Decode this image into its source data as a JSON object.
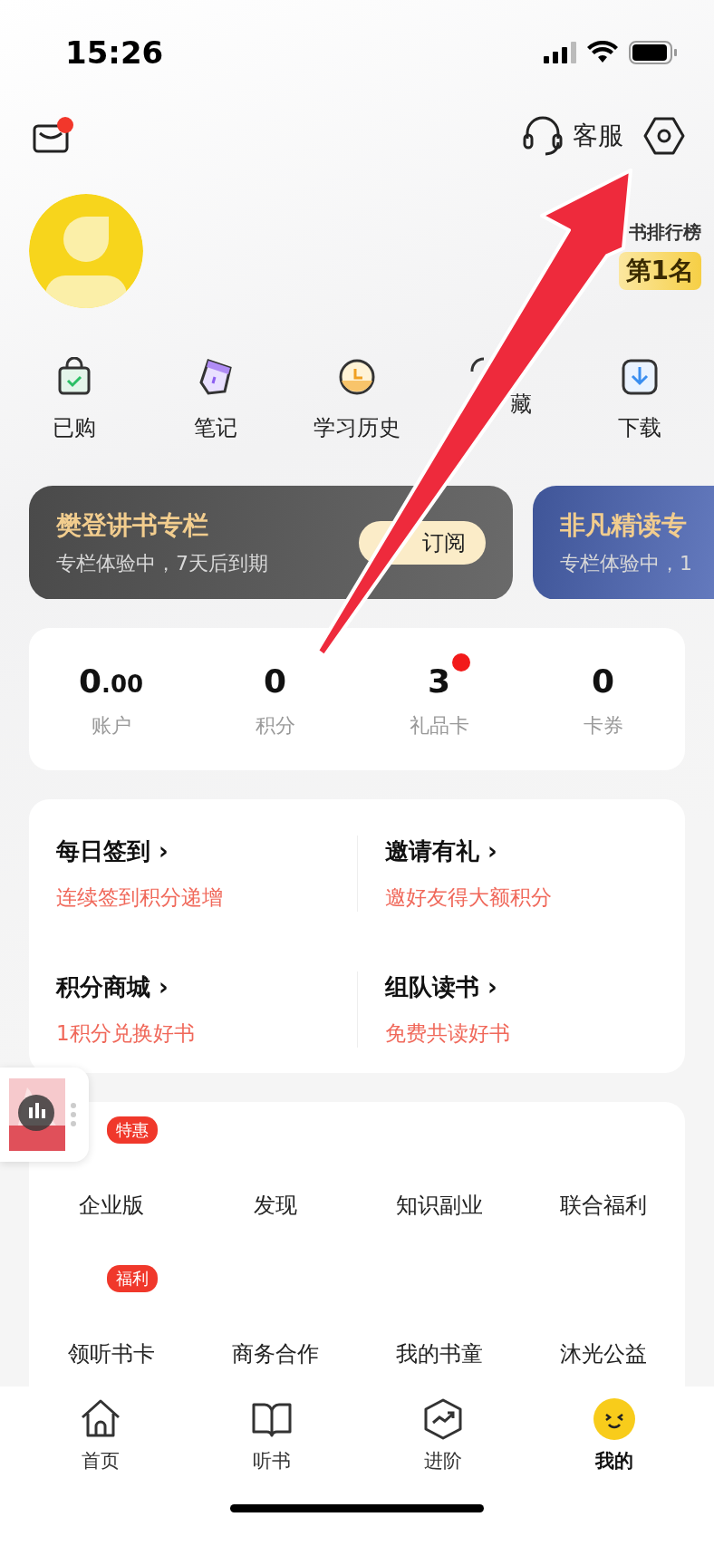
{
  "status_bar": {
    "time": "15:26"
  },
  "header": {
    "mail_badge": true,
    "service_label": "客服"
  },
  "rank_badge": {
    "title": "书排行榜",
    "rank": "第1名"
  },
  "shortcuts": [
    {
      "label": "已购"
    },
    {
      "label": "笔记"
    },
    {
      "label": "学习历史"
    },
    {
      "label": "藏"
    },
    {
      "label": "下载"
    }
  ],
  "columns": [
    {
      "title": "樊登讲书专栏",
      "subtitle": "专栏体验中，7天后到期",
      "button": "订阅"
    },
    {
      "title": "非凡精读专",
      "subtitle": "专栏体验中，1"
    }
  ],
  "stats": [
    {
      "value": "0.00",
      "label": "账户",
      "dot": false
    },
    {
      "value": "0",
      "label": "积分",
      "dot": false
    },
    {
      "value": "3",
      "label": "礼品卡",
      "dot": true
    },
    {
      "value": "0",
      "label": "卡券",
      "dot": false
    }
  ],
  "tasks": [
    {
      "title": "每日签到",
      "chevron": "›",
      "subtitle": "连续签到积分递增"
    },
    {
      "title": "邀请有礼",
      "chevron": "›",
      "subtitle": "邀好友得大额积分"
    },
    {
      "title": "积分商城",
      "chevron": "›",
      "subtitle": "1积分兑换好书"
    },
    {
      "title": "组队读书",
      "chevron": "›",
      "subtitle": "免费共读好书"
    }
  ],
  "services": [
    {
      "label": "企业版",
      "badge": "特惠"
    },
    {
      "label": "发现"
    },
    {
      "label": "知识副业"
    },
    {
      "label": "联合福利"
    },
    {
      "label": "领听书卡",
      "badge": "福利"
    },
    {
      "label": "商务合作"
    },
    {
      "label": "我的书童"
    },
    {
      "label": "沐光公益"
    }
  ],
  "tab_bar": [
    {
      "label": "首页",
      "selected": false
    },
    {
      "label": "听书",
      "selected": false
    },
    {
      "label": "进阶",
      "selected": false
    },
    {
      "label": "我的",
      "selected": true
    }
  ],
  "annotation": {
    "kind": "arrow"
  }
}
